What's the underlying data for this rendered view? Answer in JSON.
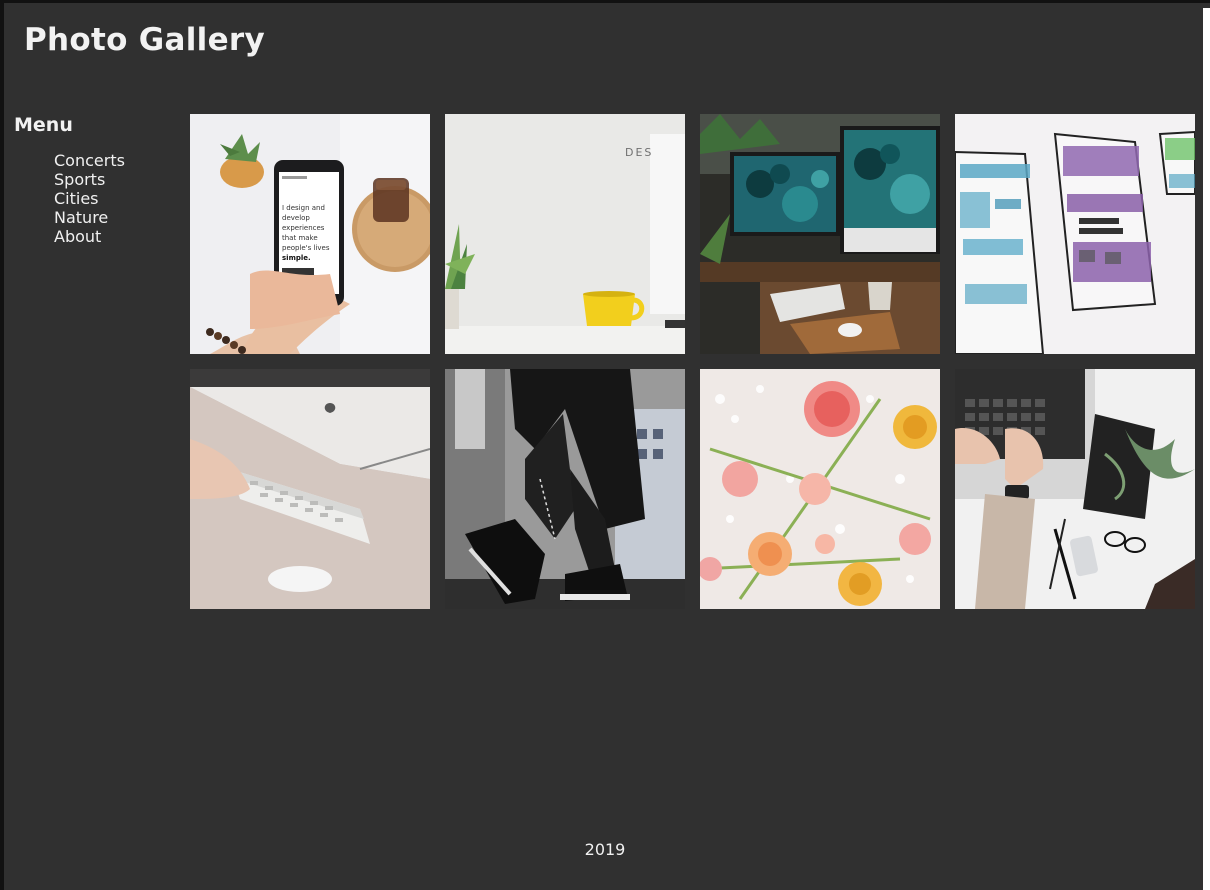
{
  "header": {
    "title": "Photo Gallery"
  },
  "sidebar": {
    "title": "Menu",
    "items": [
      {
        "label": "Concerts"
      },
      {
        "label": "Sports"
      },
      {
        "label": "Cities"
      },
      {
        "label": "Nature"
      },
      {
        "label": "About"
      }
    ]
  },
  "gallery": {
    "photos": [
      {
        "subject": "phone-in-hand",
        "screen_lines": [
          "I design and",
          "develop",
          "experiences",
          "that make",
          "people's lives",
          "simple."
        ]
      },
      {
        "subject": "yellow-mug-desk",
        "wall_text": "DES"
      },
      {
        "subject": "desk-two-monitors"
      },
      {
        "subject": "watercolor-wireframe"
      },
      {
        "subject": "keyboard-typing"
      },
      {
        "subject": "sneakers-walking"
      },
      {
        "subject": "flowers-flatlay"
      },
      {
        "subject": "laptop-typing-topview"
      }
    ]
  },
  "footer": {
    "year": "2019"
  },
  "colors": {
    "background": "#303030",
    "text": "#f0f0f0"
  }
}
